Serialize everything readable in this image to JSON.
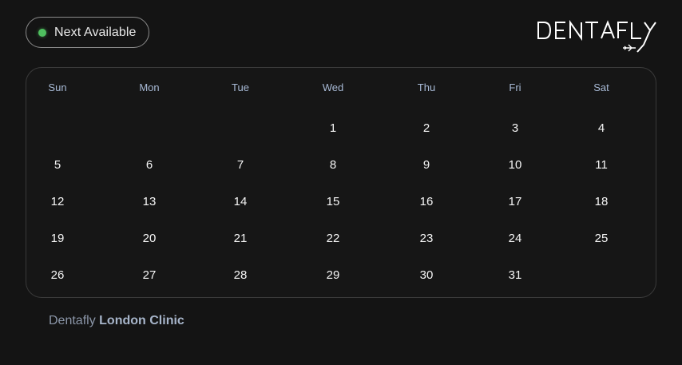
{
  "availability_button": {
    "label": "Next Available",
    "status_color": "#4fbf5f"
  },
  "brand": {
    "logo_text": "DENTAFLY",
    "icon": "airplane-icon"
  },
  "calendar": {
    "weekdays": [
      "Sun",
      "Mon",
      "Tue",
      "Wed",
      "Thu",
      "Fri",
      "Sat"
    ],
    "weeks": [
      [
        "",
        "",
        "",
        "1",
        "2",
        "3",
        "4"
      ],
      [
        "5",
        "6",
        "7",
        "8",
        "9",
        "10",
        "11"
      ],
      [
        "12",
        "13",
        "14",
        "15",
        "16",
        "17",
        "18"
      ],
      [
        "19",
        "20",
        "21",
        "22",
        "23",
        "24",
        "25"
      ],
      [
        "26",
        "27",
        "28",
        "29",
        "30",
        "31",
        ""
      ]
    ]
  },
  "footer": {
    "prefix": "Dentafly",
    "clinic": "London Clinic"
  }
}
